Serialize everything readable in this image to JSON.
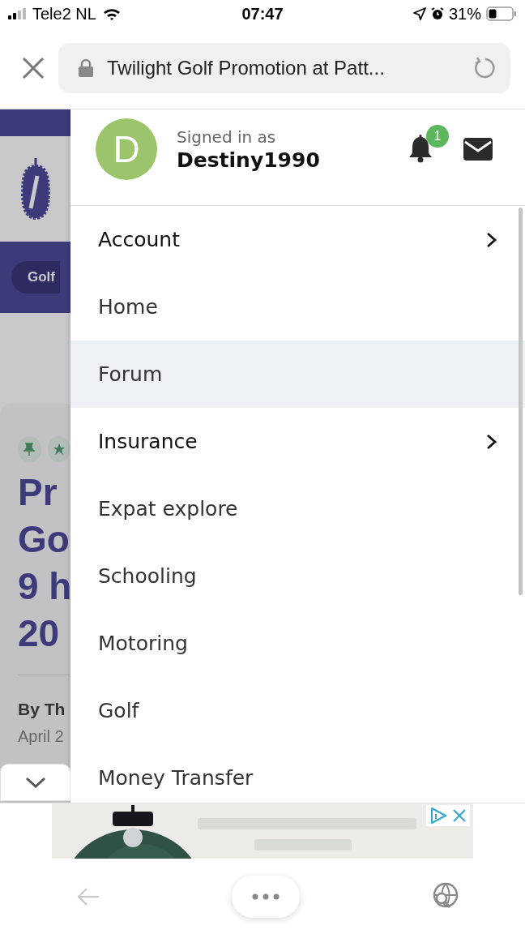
{
  "status_bar": {
    "carrier": "Tele2 NL",
    "time": "07:47",
    "battery": "31%"
  },
  "browser": {
    "url_title": "Twilight Golf Promotion at Patt..."
  },
  "background_page": {
    "breadcrumb": "Golf",
    "title_lines": [
      "Pr",
      "Go",
      "9 h",
      "20"
    ],
    "byline": "By Th",
    "date": "April 2"
  },
  "user": {
    "avatar_letter": "D",
    "signed_in_label": "Signed in as",
    "username": "Destiny1990",
    "notification_count": "1"
  },
  "menu": [
    {
      "label": "Account",
      "has_submenu": true,
      "selected": false
    },
    {
      "label": "Home",
      "has_submenu": false,
      "selected": false
    },
    {
      "label": "Forum",
      "has_submenu": false,
      "selected": true
    },
    {
      "label": "Insurance",
      "has_submenu": true,
      "selected": false
    },
    {
      "label": "Expat explore",
      "has_submenu": false,
      "selected": false
    },
    {
      "label": "Schooling",
      "has_submenu": false,
      "selected": false
    },
    {
      "label": "Motoring",
      "has_submenu": false,
      "selected": false
    },
    {
      "label": "Golf",
      "has_submenu": false,
      "selected": false
    },
    {
      "label": "Money Transfer",
      "has_submenu": false,
      "selected": false
    }
  ]
}
